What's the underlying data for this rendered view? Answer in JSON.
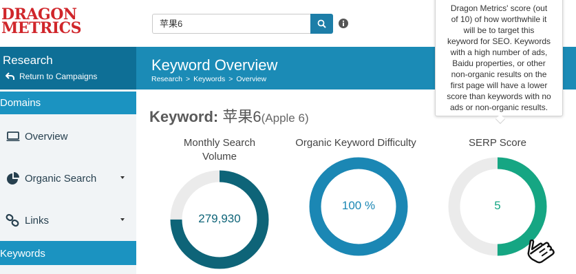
{
  "logo": {
    "line1": "DRAGON",
    "line2": "METRICS"
  },
  "search": {
    "value": "苹果6"
  },
  "sidebar": {
    "research_title": "Research",
    "return_label": "Return to Campaigns",
    "domains_section": "Domains",
    "items": [
      {
        "label": "Overview",
        "icon": "laptop-icon"
      },
      {
        "label": "Organic Search",
        "icon": "pie-chart-icon"
      },
      {
        "label": "Links",
        "icon": "link-icon"
      }
    ],
    "keywords_section": "Keywords"
  },
  "header": {
    "title": "Keyword Overview",
    "breadcrumb": [
      "Research",
      ">",
      "Keywords",
      ">",
      "Overview"
    ]
  },
  "keyword": {
    "label": "Keyword:",
    "value": "苹果6",
    "translation": "(Apple 6)"
  },
  "metrics": [
    {
      "title_line1": "Monthly Search",
      "title_line2": "Volume",
      "value": "279,930",
      "fill_fraction": 0.75,
      "color": "#0e6478"
    },
    {
      "title_line1": "Organic Keyword Difficulty",
      "title_line2": "",
      "value": "100 %",
      "fill_fraction": 1.0,
      "color": "#1b87b4"
    },
    {
      "title_line1": "SERP Score",
      "title_line2": "",
      "value": "5",
      "fill_fraction": 0.5,
      "color": "#16a683"
    }
  ],
  "tooltip": {
    "lines": [
      "Dragon Metrics' score (out",
      "of 10) of how worthwhile it",
      "will be to target this",
      "keyword for SEO. Keywords",
      "with a high number of ads,",
      "Baidu properties, or other",
      "non-organic results on the",
      "first page will have a lower",
      "score than keywords with no",
      "ads or non-organic results."
    ]
  },
  "colors": {
    "brand_red": "#d0262b",
    "header_blue": "#1b8bb6",
    "sidebar_dark": "#0e6f96",
    "sidebar_section": "#1b93c1",
    "ring_track": "#ebebeb"
  }
}
